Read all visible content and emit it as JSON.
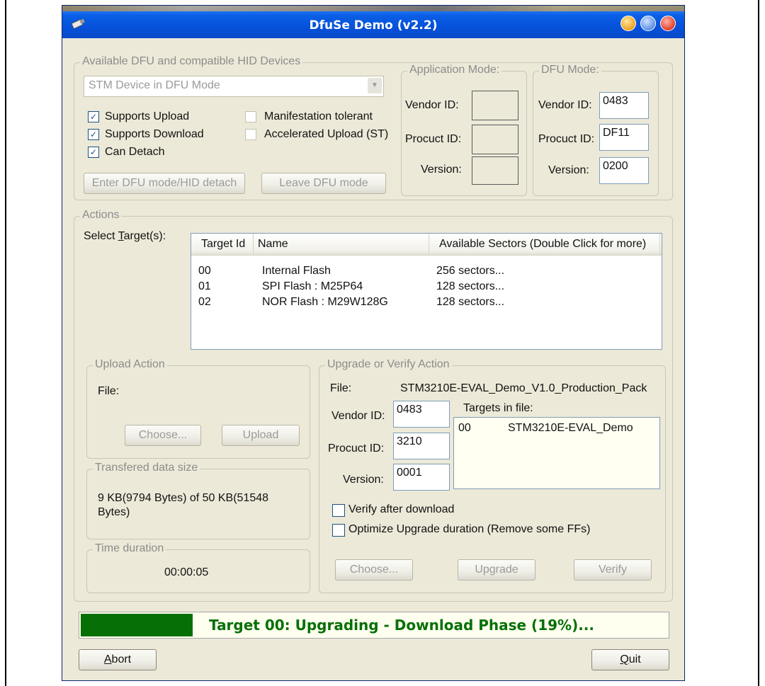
{
  "window": {
    "title": "DfuSe Demo (v2.2)",
    "icon": "usb-plug-icon"
  },
  "devices": {
    "legend": "Available DFU and compatible HID Devices",
    "selected": "STM Device in DFU Mode",
    "checkboxes": [
      {
        "label": "Supports Upload",
        "checked": true
      },
      {
        "label": "Supports Download",
        "checked": true
      },
      {
        "label": "Can Detach",
        "checked": true
      },
      {
        "label": "Manifestation tolerant",
        "checked": false
      },
      {
        "label": "Accelerated Upload (ST)",
        "checked": false
      }
    ],
    "enter_dfu_label": "Enter DFU mode/HID detach",
    "leave_dfu_label": "Leave DFU mode"
  },
  "app_mode": {
    "legend": "Application Mode:",
    "vendor_label": "Vendor ID:",
    "product_label": "Procuct ID:",
    "version_label": "Version:",
    "vendor_value": "",
    "product_value": "",
    "version_value": ""
  },
  "dfu_mode": {
    "legend": "DFU Mode:",
    "vendor_label": "Vendor ID:",
    "product_label": "Procuct ID:",
    "version_label": "Version:",
    "vendor_value": "0483",
    "product_value": "DF11",
    "version_value": "0200"
  },
  "actions": {
    "legend": "Actions",
    "select_target_label": "Select Target(s):",
    "columns": [
      "Target Id",
      "Name",
      "Available Sectors (Double Click for more)"
    ],
    "rows": [
      {
        "id": "00",
        "name": "Internal Flash",
        "sectors": "256 sectors..."
      },
      {
        "id": "01",
        "name": "SPI Flash : M25P64",
        "sectors": "128 sectors..."
      },
      {
        "id": "02",
        "name": "NOR Flash : M29W128G",
        "sectors": "128 sectors..."
      }
    ]
  },
  "upload": {
    "legend": "Upload Action",
    "file_label": "File:",
    "choose_label": "Choose...",
    "upload_label": "Upload"
  },
  "transfer": {
    "legend": "Transfered data size",
    "text": "9 KB(9794 Bytes) of 50 KB(51548 Bytes)"
  },
  "time": {
    "legend": "Time duration",
    "value": "00:00:05"
  },
  "upgrade": {
    "legend": "Upgrade or Verify Action",
    "file_label": "File:",
    "file_value": "STM3210E-EVAL_Demo_V1.0_Production_Pack",
    "vendor_label": "Vendor ID:",
    "vendor_value": "0483",
    "product_label": "Procuct ID:",
    "product_value": "3210",
    "version_label": "Version:",
    "version_value": "0001",
    "targets_label": "Targets in file:",
    "targets": [
      {
        "id": "00",
        "name": "STM3210E-EVAL_Demo"
      }
    ],
    "verify_label": "Verify after download",
    "optimize_label": "Optimize Upgrade duration (Remove some FFs)",
    "choose_label": "Choose...",
    "upgrade_label": "Upgrade",
    "verify_button_label": "Verify"
  },
  "progress": {
    "percent": 19,
    "text": "Target 00: Upgrading - Download Phase (19%)...",
    "color": "#067006"
  },
  "footer": {
    "abort_label": "Abort",
    "quit_label": "Quit"
  }
}
